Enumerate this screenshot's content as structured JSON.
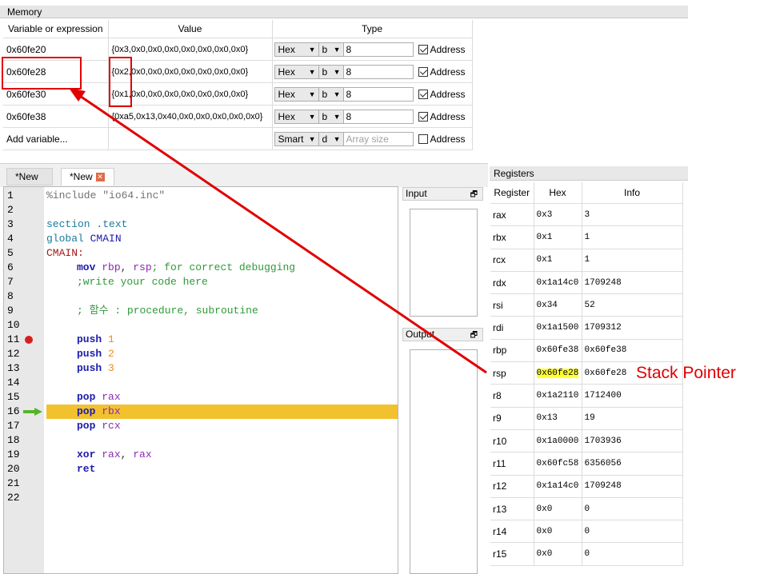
{
  "memory": {
    "title": "Memory",
    "columns": [
      "Variable or expression",
      "Value",
      "Type"
    ],
    "rows": [
      {
        "expr": "0x60fe20",
        "value": "{0x3,0x0,0x0,0x0,0x0,0x0,0x0,0x0}",
        "format": "Hex",
        "size": "b",
        "count": "8",
        "address_label": "Address",
        "address_checked": true
      },
      {
        "expr": "0x60fe28",
        "value": "{0x2,0x0,0x0,0x0,0x0,0x0,0x0,0x0}",
        "format": "Hex",
        "size": "b",
        "count": "8",
        "address_label": "Address",
        "address_checked": true
      },
      {
        "expr": "0x60fe30",
        "value": "{0x1,0x0,0x0,0x0,0x0,0x0,0x0,0x0}",
        "format": "Hex",
        "size": "b",
        "count": "8",
        "address_label": "Address",
        "address_checked": true
      },
      {
        "expr": "0x60fe38",
        "value": "{0xa5,0x13,0x40,0x0,0x0,0x0,0x0,0x0}",
        "format": "Hex",
        "size": "b",
        "count": "8",
        "address_label": "Address",
        "address_checked": true
      }
    ],
    "add_row": {
      "expr": "Add variable...",
      "format": "Smart",
      "size": "d",
      "count_placeholder": "Array size",
      "address_label": "Address",
      "address_checked": false
    }
  },
  "editor": {
    "tabs": [
      {
        "label": "*New",
        "active": false
      },
      {
        "label": "*New",
        "active": true
      }
    ],
    "line_numbers": [
      "1",
      "2",
      "3",
      "4",
      "5",
      "6",
      "7",
      "8",
      "9",
      "10",
      "11",
      "12",
      "13",
      "14",
      "15",
      "16",
      "17",
      "18",
      "19",
      "20",
      "21",
      "22"
    ],
    "breakpoint_line": 11,
    "current_line": 16,
    "code": {
      "l1_kw": "%include",
      "l1_str": " \"io64.inc\"",
      "l3": "section .text",
      "l4_kw": "global ",
      "l4_name": "CMAIN",
      "l5": "CMAIN:",
      "l6_op": "mov ",
      "l6_r1": "rbp",
      "l6_comma": ", ",
      "l6_r2": "rsp",
      "l6_com": "; for correct debugging",
      "l7": ";write your code here",
      "l9": "; 함수 : procedure, subroutine",
      "l11_op": "push ",
      "l11_n": "1",
      "l12_op": "push ",
      "l12_n": "2",
      "l13_op": "push ",
      "l13_n": "3",
      "l15_op": "pop ",
      "l15_r": "rax",
      "l16_op": "pop ",
      "l16_r": "rbx",
      "l17_op": "pop ",
      "l17_r": "rcx",
      "l19_op": "xor ",
      "l19_r1": "rax",
      "l19_comma": ", ",
      "l19_r2": "rax",
      "l20_op": "ret"
    }
  },
  "input_panel": {
    "title": "Input"
  },
  "output_panel": {
    "title": "Output"
  },
  "registers": {
    "title": "Registers",
    "columns": [
      "Register",
      "Hex",
      "Info"
    ],
    "rows": [
      {
        "name": "rax",
        "hex": "0x3",
        "info": "3"
      },
      {
        "name": "rbx",
        "hex": "0x1",
        "info": "1"
      },
      {
        "name": "rcx",
        "hex": "0x1",
        "info": "1"
      },
      {
        "name": "rdx",
        "hex": "0x1a14c0",
        "info": "1709248"
      },
      {
        "name": "rsi",
        "hex": "0x34",
        "info": "52"
      },
      {
        "name": "rdi",
        "hex": "0x1a1500",
        "info": "1709312"
      },
      {
        "name": "rbp",
        "hex": "0x60fe38",
        "info": "0x60fe38"
      },
      {
        "name": "rsp",
        "hex": "0x60fe28",
        "info": "0x60fe28",
        "highlight": true
      },
      {
        "name": "r8",
        "hex": "0x1a2110",
        "info": "1712400"
      },
      {
        "name": "r9",
        "hex": "0x13",
        "info": "19"
      },
      {
        "name": "r10",
        "hex": "0x1a0000",
        "info": "1703936"
      },
      {
        "name": "r11",
        "hex": "0x60fc58",
        "info": "6356056"
      },
      {
        "name": "r12",
        "hex": "0x1a14c0",
        "info": "1709248"
      },
      {
        "name": "r13",
        "hex": "0x0",
        "info": "0"
      },
      {
        "name": "r14",
        "hex": "0x0",
        "info": "0"
      },
      {
        "name": "r15",
        "hex": "0x0",
        "info": "0"
      }
    ]
  },
  "annotation": {
    "label": "Stack Pointer",
    "color": "#e00000"
  },
  "colors": {
    "highlight_line": "#f2c12e",
    "rsp_highlight": "#ffff33",
    "breakpoint": "#d81e1e",
    "exec_arrow": "#56b42a"
  }
}
